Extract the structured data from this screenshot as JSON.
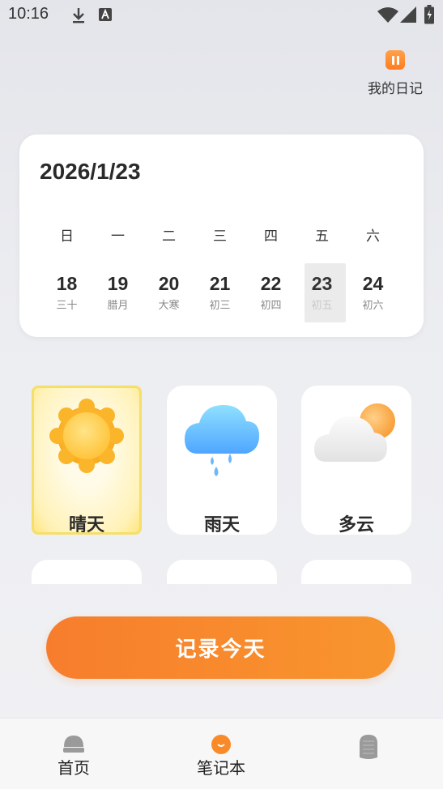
{
  "status_bar": {
    "time": "10:16",
    "icons": [
      "download-icon",
      "a-icon",
      "wifi-icon",
      "signal-icon",
      "battery-icon"
    ]
  },
  "header": {
    "diary_label": "我的日记",
    "diary_icon": "pause-icon"
  },
  "calendar": {
    "date": "2026/1/23",
    "weekdays": [
      "日",
      "一",
      "二",
      "三",
      "四",
      "五",
      "六"
    ],
    "days": [
      {
        "num": "18",
        "lunar": "三十"
      },
      {
        "num": "19",
        "lunar": "腊月"
      },
      {
        "num": "20",
        "lunar": "大寒"
      },
      {
        "num": "21",
        "lunar": "初三"
      },
      {
        "num": "22",
        "lunar": "初四"
      },
      {
        "num": "23",
        "lunar": "初五",
        "selected": true
      },
      {
        "num": "24",
        "lunar": "初六"
      }
    ]
  },
  "weather": {
    "options": [
      {
        "label": "晴天",
        "icon": "sun-icon",
        "selected": true
      },
      {
        "label": "雨天",
        "icon": "rain-cloud-icon"
      },
      {
        "label": "多云",
        "icon": "cloudy-icon"
      }
    ]
  },
  "record_button": {
    "label": "记录今天"
  },
  "bottom_nav": {
    "items": [
      {
        "label": "首页",
        "icon": "home-icon"
      },
      {
        "label": "笔记本",
        "icon": "notebook-icon",
        "active": true
      },
      {
        "label": "",
        "icon": "profile-icon"
      }
    ]
  },
  "colors": {
    "accent": "#f7832d",
    "selected_sun_border": "#f5df6a"
  }
}
